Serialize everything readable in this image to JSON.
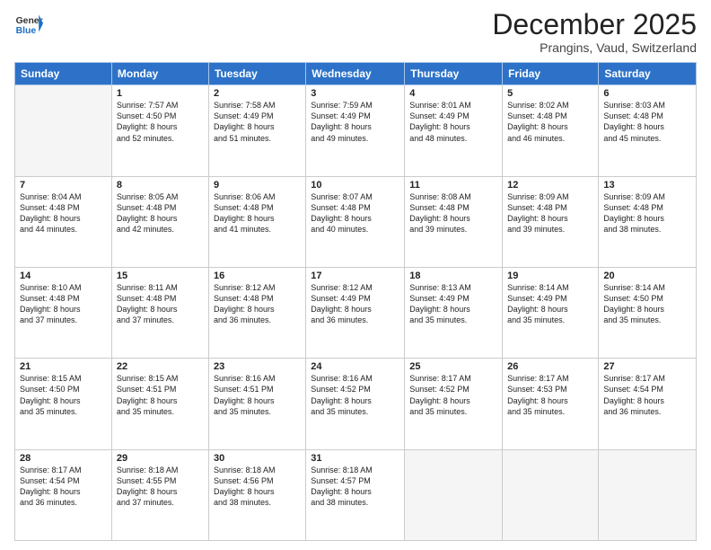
{
  "header": {
    "logo_general": "General",
    "logo_blue": "Blue",
    "month_title": "December 2025",
    "location": "Prangins, Vaud, Switzerland"
  },
  "days_of_week": [
    "Sunday",
    "Monday",
    "Tuesday",
    "Wednesday",
    "Thursday",
    "Friday",
    "Saturday"
  ],
  "weeks": [
    [
      {
        "day": "",
        "info": ""
      },
      {
        "day": "1",
        "info": "Sunrise: 7:57 AM\nSunset: 4:50 PM\nDaylight: 8 hours\nand 52 minutes."
      },
      {
        "day": "2",
        "info": "Sunrise: 7:58 AM\nSunset: 4:49 PM\nDaylight: 8 hours\nand 51 minutes."
      },
      {
        "day": "3",
        "info": "Sunrise: 7:59 AM\nSunset: 4:49 PM\nDaylight: 8 hours\nand 49 minutes."
      },
      {
        "day": "4",
        "info": "Sunrise: 8:01 AM\nSunset: 4:49 PM\nDaylight: 8 hours\nand 48 minutes."
      },
      {
        "day": "5",
        "info": "Sunrise: 8:02 AM\nSunset: 4:48 PM\nDaylight: 8 hours\nand 46 minutes."
      },
      {
        "day": "6",
        "info": "Sunrise: 8:03 AM\nSunset: 4:48 PM\nDaylight: 8 hours\nand 45 minutes."
      }
    ],
    [
      {
        "day": "7",
        "info": "Sunrise: 8:04 AM\nSunset: 4:48 PM\nDaylight: 8 hours\nand 44 minutes."
      },
      {
        "day": "8",
        "info": "Sunrise: 8:05 AM\nSunset: 4:48 PM\nDaylight: 8 hours\nand 42 minutes."
      },
      {
        "day": "9",
        "info": "Sunrise: 8:06 AM\nSunset: 4:48 PM\nDaylight: 8 hours\nand 41 minutes."
      },
      {
        "day": "10",
        "info": "Sunrise: 8:07 AM\nSunset: 4:48 PM\nDaylight: 8 hours\nand 40 minutes."
      },
      {
        "day": "11",
        "info": "Sunrise: 8:08 AM\nSunset: 4:48 PM\nDaylight: 8 hours\nand 39 minutes."
      },
      {
        "day": "12",
        "info": "Sunrise: 8:09 AM\nSunset: 4:48 PM\nDaylight: 8 hours\nand 39 minutes."
      },
      {
        "day": "13",
        "info": "Sunrise: 8:09 AM\nSunset: 4:48 PM\nDaylight: 8 hours\nand 38 minutes."
      }
    ],
    [
      {
        "day": "14",
        "info": "Sunrise: 8:10 AM\nSunset: 4:48 PM\nDaylight: 8 hours\nand 37 minutes."
      },
      {
        "day": "15",
        "info": "Sunrise: 8:11 AM\nSunset: 4:48 PM\nDaylight: 8 hours\nand 37 minutes."
      },
      {
        "day": "16",
        "info": "Sunrise: 8:12 AM\nSunset: 4:48 PM\nDaylight: 8 hours\nand 36 minutes."
      },
      {
        "day": "17",
        "info": "Sunrise: 8:12 AM\nSunset: 4:49 PM\nDaylight: 8 hours\nand 36 minutes."
      },
      {
        "day": "18",
        "info": "Sunrise: 8:13 AM\nSunset: 4:49 PM\nDaylight: 8 hours\nand 35 minutes."
      },
      {
        "day": "19",
        "info": "Sunrise: 8:14 AM\nSunset: 4:49 PM\nDaylight: 8 hours\nand 35 minutes."
      },
      {
        "day": "20",
        "info": "Sunrise: 8:14 AM\nSunset: 4:50 PM\nDaylight: 8 hours\nand 35 minutes."
      }
    ],
    [
      {
        "day": "21",
        "info": "Sunrise: 8:15 AM\nSunset: 4:50 PM\nDaylight: 8 hours\nand 35 minutes."
      },
      {
        "day": "22",
        "info": "Sunrise: 8:15 AM\nSunset: 4:51 PM\nDaylight: 8 hours\nand 35 minutes."
      },
      {
        "day": "23",
        "info": "Sunrise: 8:16 AM\nSunset: 4:51 PM\nDaylight: 8 hours\nand 35 minutes."
      },
      {
        "day": "24",
        "info": "Sunrise: 8:16 AM\nSunset: 4:52 PM\nDaylight: 8 hours\nand 35 minutes."
      },
      {
        "day": "25",
        "info": "Sunrise: 8:17 AM\nSunset: 4:52 PM\nDaylight: 8 hours\nand 35 minutes."
      },
      {
        "day": "26",
        "info": "Sunrise: 8:17 AM\nSunset: 4:53 PM\nDaylight: 8 hours\nand 35 minutes."
      },
      {
        "day": "27",
        "info": "Sunrise: 8:17 AM\nSunset: 4:54 PM\nDaylight: 8 hours\nand 36 minutes."
      }
    ],
    [
      {
        "day": "28",
        "info": "Sunrise: 8:17 AM\nSunset: 4:54 PM\nDaylight: 8 hours\nand 36 minutes."
      },
      {
        "day": "29",
        "info": "Sunrise: 8:18 AM\nSunset: 4:55 PM\nDaylight: 8 hours\nand 37 minutes."
      },
      {
        "day": "30",
        "info": "Sunrise: 8:18 AM\nSunset: 4:56 PM\nDaylight: 8 hours\nand 38 minutes."
      },
      {
        "day": "31",
        "info": "Sunrise: 8:18 AM\nSunset: 4:57 PM\nDaylight: 8 hours\nand 38 minutes."
      },
      {
        "day": "",
        "info": ""
      },
      {
        "day": "",
        "info": ""
      },
      {
        "day": "",
        "info": ""
      }
    ]
  ]
}
